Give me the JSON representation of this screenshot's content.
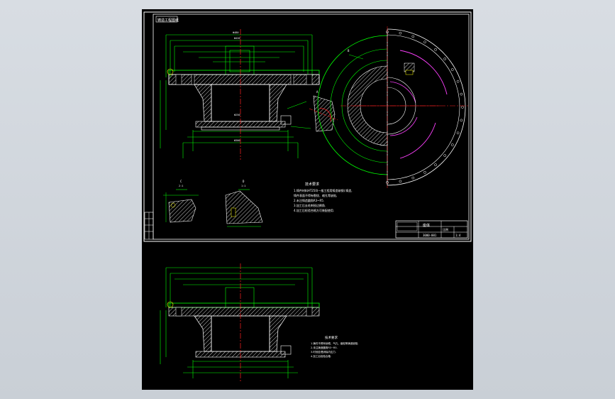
{
  "drawing": {
    "border_tag": "铸造工程图纸",
    "title_block": {
      "part_name": "座体",
      "drawing_no": "3000-001",
      "scale_label": "比例",
      "scale_value": "1:4"
    },
    "view_labels": {
      "top_left_section": "A",
      "circular_detail": "B",
      "detail_c": "C",
      "detail_c_scale": "2:1",
      "detail_d": "D",
      "detail_d_scale": "1:1"
    },
    "tech_requirements_title": "技术要求",
    "tech_requirements": [
      "1.铸件材料HT250(一般工程用铸造碳钢).铸造,",
      "  铸件表面不得有裂纹、缩孔等缺陷,",
      "2.未注铸造圆角R3~R5.",
      "3.加工后去毛刺锐边倒角.",
      "4.加工后检验合格方可装配使用."
    ],
    "tech_requirements_2_title": "技术要求",
    "tech_requirements_2": [
      "1.铸件不得有砂眼、气孔、缩松等铸造缺陷.",
      "2.未注铸造圆角R3~R5.",
      "3.时效处理消除内应力.",
      "4.加工后检验合格."
    ],
    "dimensions": {
      "top_overall": "Φ480",
      "flange": "Φ420",
      "bore": "Φ250",
      "base": "Φ300",
      "height": "180"
    },
    "colors": {
      "background": "#000000",
      "lines": "#00ff00",
      "center": "#ff2020",
      "hatch": "#ffffff",
      "pattern": "#ff40ff",
      "text": "#ffffff"
    }
  }
}
